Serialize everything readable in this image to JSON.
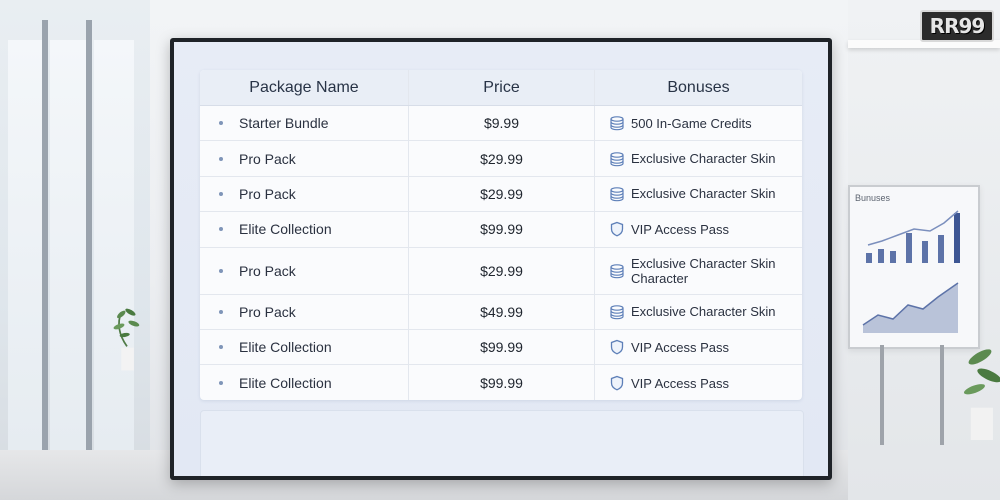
{
  "logo_text": "RR99",
  "whiteboard": {
    "title": "Bunuses"
  },
  "table": {
    "headers": {
      "name": "Package Name",
      "price": "Price",
      "bonuses": "Bonuses"
    },
    "rows": [
      {
        "name": "Starter Bundle",
        "price": "$9.99",
        "bonus": "500 In-Game Credits",
        "icon": "coins-icon"
      },
      {
        "name": "Pro Pack",
        "price": "$29.99",
        "bonus": "Exclusive Character Skin",
        "icon": "coins-icon"
      },
      {
        "name": "Pro Pack",
        "price": "$29.99",
        "bonus": "Exclusive Character Skin",
        "icon": "coins-icon"
      },
      {
        "name": "Elite Collection",
        "price": "$99.99",
        "bonus": "VIP Access Pass",
        "icon": "shield-icon"
      },
      {
        "name": "Pro Pack",
        "price": "$29.99",
        "bonus": "Exclusive Character Skin",
        "bonus_line2": "Character",
        "icon": "coins-icon"
      },
      {
        "name": "Pro Pack",
        "price": "$49.99",
        "bonus": "Exclusive Character Skin",
        "icon": "coins-icon"
      },
      {
        "name": "Elite Collection",
        "price": "$99.99",
        "bonus": "VIP Access Pass",
        "icon": "shield-icon"
      },
      {
        "name": "Elite Collection",
        "price": "$99.99",
        "bonus": "VIP Access Pass",
        "icon": "shield-icon"
      }
    ]
  },
  "colors": {
    "header_bg": "#e9eef6",
    "icon_blue": "#5d7fb8",
    "screen_bg": "#e4e9f5"
  }
}
